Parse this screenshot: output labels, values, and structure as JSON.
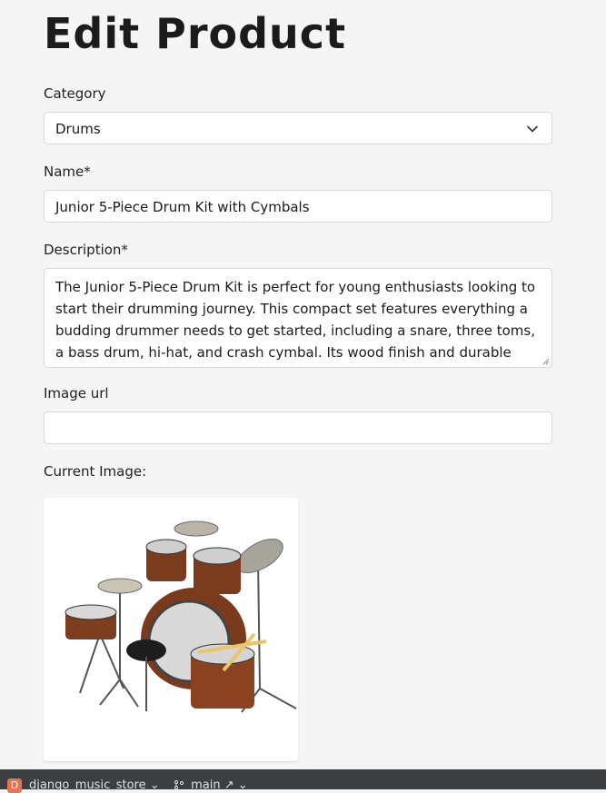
{
  "page": {
    "title": "Edit Product"
  },
  "form": {
    "category": {
      "label": "Category",
      "value": "Drums"
    },
    "name": {
      "label": "Name*",
      "value": "Junior 5-Piece Drum Kit with Cymbals"
    },
    "description": {
      "label": "Description*",
      "value": "The Junior 5-Piece Drum Kit is perfect for young enthusiasts looking to start their drumming journey. This compact set features everything a budding drummer needs to get started, including a snare, three toms, a bass drum, hi-hat, and crash cymbal. Its wood finish and durable hardware"
    },
    "image_url": {
      "label": "Image url",
      "value": ""
    },
    "current_image": {
      "label": "Current Image:"
    }
  },
  "statusbar": {
    "badge": "D",
    "project": "django_music_store ⌄",
    "branch": "main ↗ ⌄"
  },
  "colors": {
    "accent": "#e8734f",
    "statusbar": "#3c3f41"
  },
  "icons": [
    "chevron-down-icon",
    "resize-handle-icon",
    "branch-icon"
  ]
}
